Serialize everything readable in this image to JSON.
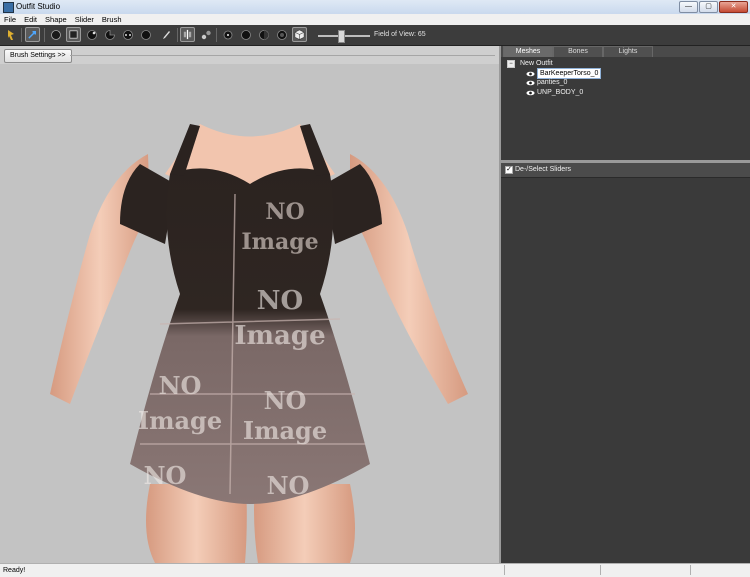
{
  "window": {
    "title": "Outfit Studio",
    "min": "—",
    "max": "▢",
    "close": "✕"
  },
  "menu": [
    "File",
    "Edit",
    "Shape",
    "Slider",
    "Brush"
  ],
  "toolbar": {
    "field_of_view": "Field of View: 65",
    "fov_fraction": 0.43,
    "icons": [
      "select-brush",
      "transform",
      "inflate",
      "deflate",
      "move",
      "smooth",
      "mask",
      "unmask",
      "weight",
      "color",
      "alpha",
      "sphere",
      "grid",
      "dot-small",
      "sphere-large",
      "sphere-half",
      "sphere-dark",
      "cube"
    ]
  },
  "left": {
    "brush_settings_label": "Brush Settings >>"
  },
  "right": {
    "tabs": [
      "Meshes",
      "Bones",
      "Lights"
    ],
    "tree": {
      "root": "New Outfit",
      "expander": "−",
      "items": [
        "BarKeeperTorso_0",
        "panties_0",
        "UNP_BODY_0"
      ]
    },
    "sliders_label": "De-/Select Sliders",
    "sliders_checked": "✓"
  },
  "viewport_text": {
    "label_line1": "NO",
    "label_line2": "Image"
  },
  "status": {
    "text": "Ready!"
  },
  "colors": {
    "toolbar": "#3c3c3c",
    "panel": "#3a3a3a",
    "viewport": "#c3c3c3",
    "skin": "#e8b8a0",
    "dress_top": "#2f2622",
    "dress_bottom": "#7a6866"
  }
}
